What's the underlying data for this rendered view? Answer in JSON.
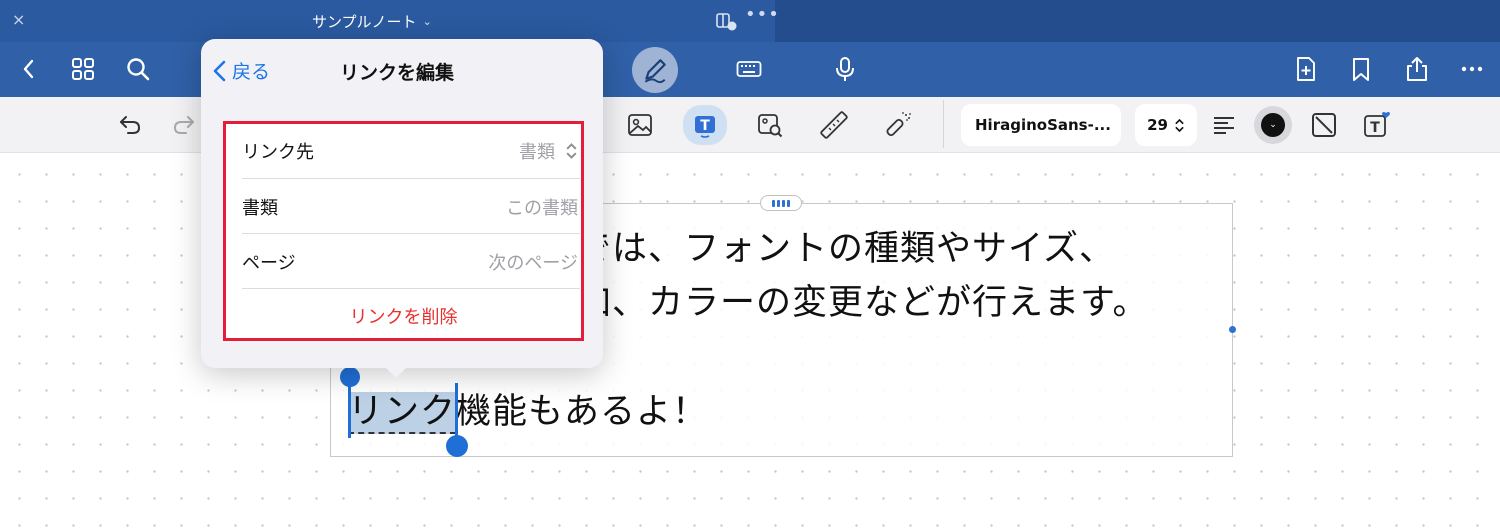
{
  "titlebar": {
    "close_glyph": "×",
    "doc_title": "サンプルノート",
    "title_chevron": "⌄",
    "more_dots": "•••"
  },
  "navbar": {
    "icons": [
      "back-chevron-icon",
      "grid-icon",
      "search-icon",
      "pen-icon",
      "keyboard-icon",
      "microphone-icon",
      "add-page-icon",
      "bookmark-icon",
      "share-icon",
      "more-icon"
    ]
  },
  "toolbar": {
    "font_name": "HiraginoSans-...",
    "font_size": "29",
    "size_chevron": "⌃⌄",
    "color_chevron": "⌄"
  },
  "popover": {
    "back_label": "戻る",
    "title": "リンクを編集",
    "rows": [
      {
        "label": "リンク先",
        "value": "書類"
      },
      {
        "label": "書類",
        "value": "この書類"
      },
      {
        "label": "ページ",
        "value": "次のページ"
      }
    ],
    "delete_label": "リンクを削除"
  },
  "note": {
    "line1": "では、フォントの種類やサイズ、",
    "line2": "加、カラーの変更などが行えます。",
    "selected_text": "リンク",
    "line3_rest": "機能もあるよ！"
  },
  "colors": {
    "titlebar_bg": "#2b5aa0",
    "navbar_bg": "#3060a8",
    "accent_blue": "#1e74e6",
    "highlight_red": "#e41e3a",
    "destructive": "#e8312f"
  }
}
